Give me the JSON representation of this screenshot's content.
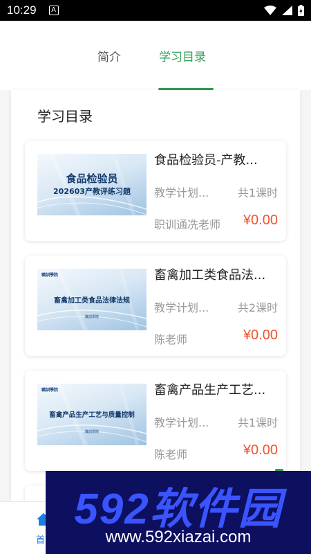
{
  "status_bar": {
    "time": "10:29",
    "a_badge": "A"
  },
  "tabs": {
    "intro": "简介",
    "catalog": "学习目录",
    "active_color": "#2e9e57"
  },
  "section_title": "学习目录",
  "courses": [
    {
      "thumb_line1": "食品检验员",
      "thumb_line2": "202603产教评练习题",
      "title": "食品检验员-产教...",
      "plan": "教学计划...",
      "lessons": "共1课时",
      "teacher": "职训通冼老师",
      "price": "¥0.00"
    },
    {
      "thumb_logo": "職訓學院",
      "thumb_line1": "畜禽加工类食品法律法规",
      "title": "畜禽加工类食品法...",
      "plan": "教学计划...",
      "lessons": "共2课时",
      "teacher": "陈老师",
      "price": "¥0.00"
    },
    {
      "thumb_logo": "職訓學院",
      "thumb_line1": "畜禽产品生产工艺与质量控制",
      "title": "畜禽产品生产工艺...",
      "plan": "教学计划...",
      "lessons": "共1课时",
      "teacher": "陈老师",
      "price": "¥0.00"
    }
  ],
  "bottom_nav": {
    "home_label": "首"
  },
  "watermark": {
    "main": "592软件园",
    "url": "www.592xiazai.com"
  },
  "colors": {
    "price": "#f0532d",
    "accent": "#2e9e57",
    "nav_active": "#1e7de0"
  },
  "icons": [
    "wifi-icon",
    "signal-icon",
    "battery-icon",
    "home-icon"
  ]
}
